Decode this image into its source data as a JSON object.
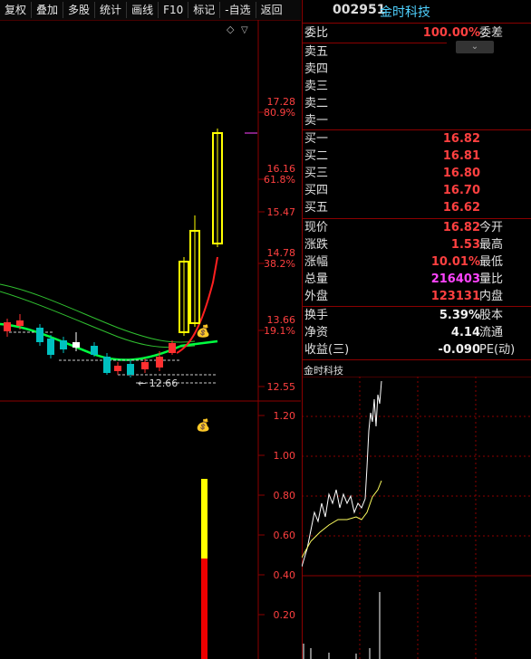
{
  "toolbar": {
    "items": [
      "复权",
      "叠加",
      "多股",
      "统计",
      "画线",
      "F10",
      "标记",
      "-自选",
      "返回"
    ]
  },
  "chart": {
    "price_axis": [
      "17.28",
      "80.9%",
      "16.16",
      "61.8%",
      "15.47",
      "14.78",
      "38.2%",
      "13.66",
      "19.1%",
      "12.55"
    ],
    "low_label": "← 12.66",
    "volume_axis": [
      "1.20",
      "1.00",
      "0.80",
      "0.60",
      "0.40",
      "0.20"
    ],
    "icons": [
      "money-bag-icon",
      "diamond-icon",
      "chevron-down-icon"
    ],
    "colors": {
      "bull": "#ff3030",
      "bear": "#00c0c0",
      "limit": "#ffff00",
      "ma_green": "#00ff40",
      "ma_red": "#ff2020",
      "grid": "#8b0000"
    }
  },
  "quote": {
    "code": "002951",
    "name": "金时科技",
    "webi_label": "委比",
    "webi_value": "100.00%",
    "weicha_label": "委差",
    "sell_levels": [
      {
        "label": "卖五"
      },
      {
        "label": "卖四"
      },
      {
        "label": "卖三"
      },
      {
        "label": "卖二"
      },
      {
        "label": "卖一"
      }
    ],
    "buy_levels": [
      {
        "label": "买一",
        "price": "16.82"
      },
      {
        "label": "买二",
        "price": "16.81"
      },
      {
        "label": "买三",
        "price": "16.80"
      },
      {
        "label": "买四",
        "price": "16.70"
      },
      {
        "label": "买五",
        "price": "16.62"
      }
    ],
    "stats": [
      {
        "label": "现价",
        "value": "16.82",
        "label2": "今开",
        "color": "red"
      },
      {
        "label": "涨跌",
        "value": "1.53",
        "label2": "最高",
        "color": "red"
      },
      {
        "label": "涨幅",
        "value": "10.01%",
        "label2": "最低",
        "color": "red"
      },
      {
        "label": "总量",
        "value": "216403",
        "label2": "量比",
        "color": "magenta"
      },
      {
        "label": "外盘",
        "value": "123131",
        "label2": "内盘",
        "color": "red"
      }
    ],
    "stats2": [
      {
        "label": "换手",
        "value": "5.39%",
        "label2": "股本"
      },
      {
        "label": "净资",
        "value": "4.14",
        "label2": "流通"
      },
      {
        "label": "收益(三)",
        "value": "-0.090",
        "label2": "PE(动)"
      }
    ],
    "mini_chart_title": "金时科技"
  }
}
